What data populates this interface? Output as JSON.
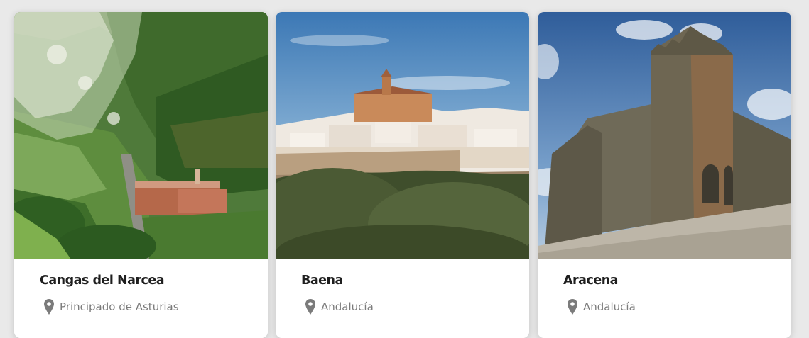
{
  "cards": [
    {
      "title": "Cangas del Narcea",
      "location": "Principado de Asturias",
      "location_icon": "map-pin-icon"
    },
    {
      "title": "Baena",
      "location": "Andalucía",
      "location_icon": "map-pin-icon"
    },
    {
      "title": "Aracena",
      "location": "Andalucía",
      "location_icon": "map-pin-icon"
    }
  ],
  "colors": {
    "page_background": "#e9e9e9",
    "card_background": "#ffffff",
    "title_text": "#1f1f1f",
    "location_text": "#7b7b7b",
    "pin_icon": "#7b7b7b"
  }
}
